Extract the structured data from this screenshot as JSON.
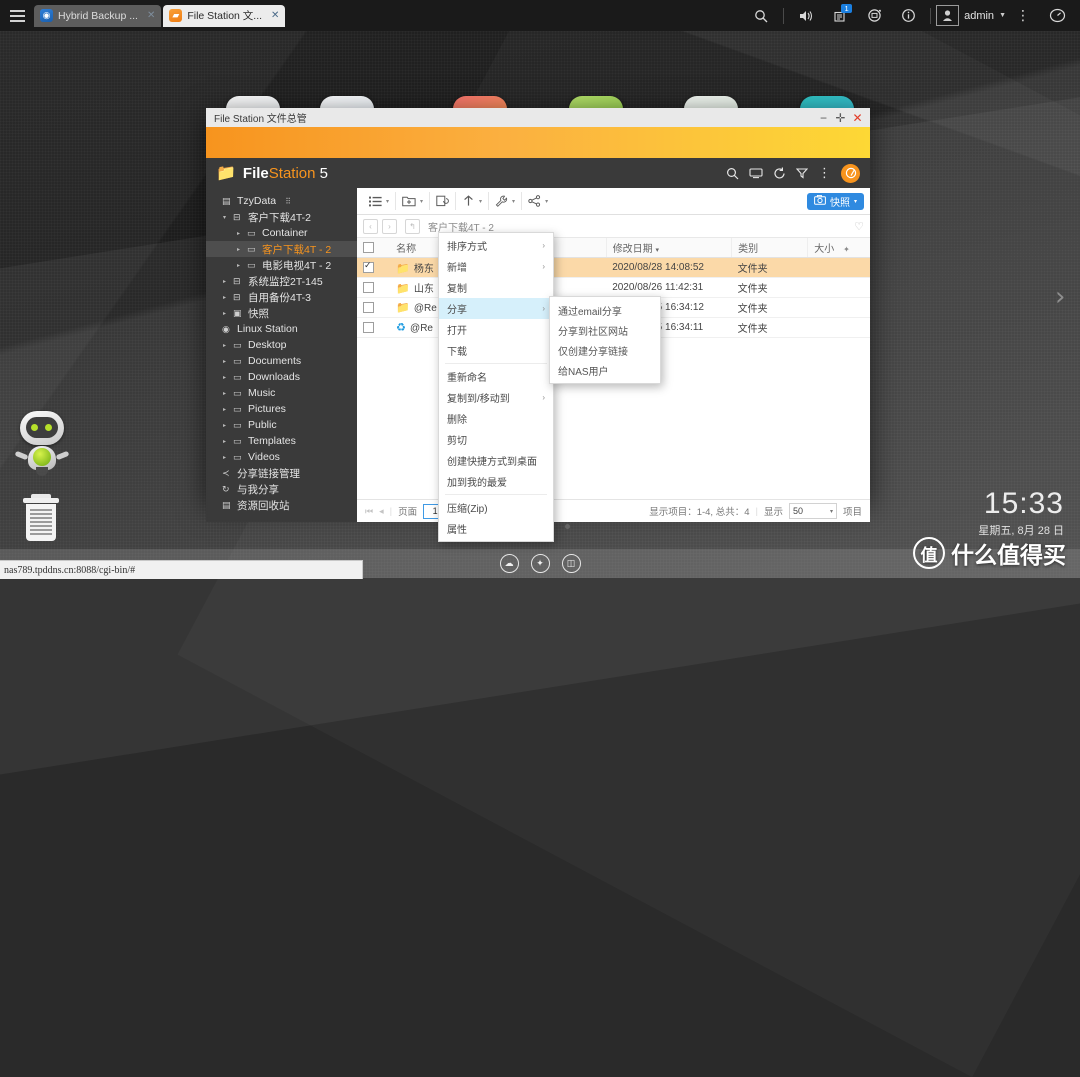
{
  "topbar": {
    "menu_icon": "hamburger-icon",
    "tabs": [
      {
        "label": "Hybrid Backup ...",
        "icon": "hybrid-backup-icon",
        "active": false,
        "close": "✕"
      },
      {
        "label": "File Station 文...",
        "icon": "file-station-icon",
        "active": true,
        "close": "✕"
      }
    ],
    "icons": [
      {
        "name": "search-icon",
        "glyph": "⌕"
      },
      {
        "name": "volume-icon",
        "glyph": "🔊"
      },
      {
        "name": "notifications-icon",
        "glyph": "▤",
        "badge": "1"
      },
      {
        "name": "background-tasks-icon",
        "glyph": "⟳"
      },
      {
        "name": "info-icon",
        "glyph": "ⓘ"
      }
    ],
    "admin_label": "admin",
    "admin_caret": "▼",
    "more_icon": "more-vertical-icon",
    "dashboard_icon": "dashboard-icon"
  },
  "window": {
    "titlebar_text": "File Station 文件总管",
    "minimize": "−",
    "maximize": "✛",
    "close": "✕",
    "app_name_bold": "File",
    "app_name_rest": "Station",
    "app_version": "5",
    "header_icons": [
      {
        "name": "search-icon",
        "glyph": "⌕"
      },
      {
        "name": "remote-connection-icon",
        "glyph": "▭"
      },
      {
        "name": "refresh-icon",
        "glyph": "⟳"
      },
      {
        "name": "filter-icon",
        "glyph": "▽"
      },
      {
        "name": "more-options-icon",
        "glyph": "⋮"
      }
    ],
    "help_icon": "help-icon"
  },
  "sidebar": {
    "items": [
      {
        "label": "TzyData",
        "depth": 1,
        "icon": "server-icon",
        "arrow": "",
        "selected": false,
        "extra": "⠿"
      },
      {
        "label": "客户下载4T-2",
        "depth": 2,
        "icon": "volume-icon",
        "arrow": "▾",
        "selected": false
      },
      {
        "label": "Container",
        "depth": 3,
        "icon": "folder-icon",
        "arrow": "▸",
        "selected": false
      },
      {
        "label": "客户下载4T - 2",
        "depth": 3,
        "icon": "folder-icon",
        "arrow": "▸",
        "selected": true
      },
      {
        "label": "电影电视4T - 2",
        "depth": 3,
        "icon": "folder-icon",
        "arrow": "▸",
        "selected": false
      },
      {
        "label": "系统监控2T-145",
        "depth": 2,
        "icon": "volume-icon",
        "arrow": "▸",
        "selected": false
      },
      {
        "label": "自用备份4T-3",
        "depth": 2,
        "icon": "volume-icon",
        "arrow": "▸",
        "selected": false
      },
      {
        "label": "快照",
        "depth": 2,
        "icon": "snapshot-icon",
        "arrow": "▸",
        "selected": false
      },
      {
        "label": "Linux Station",
        "depth": 1,
        "icon": "linux-station-icon",
        "arrow": "",
        "selected": false
      },
      {
        "label": "Desktop",
        "depth": 2,
        "icon": "folder-icon",
        "arrow": "▸",
        "selected": false
      },
      {
        "label": "Documents",
        "depth": 2,
        "icon": "folder-icon",
        "arrow": "▸",
        "selected": false
      },
      {
        "label": "Downloads",
        "depth": 2,
        "icon": "folder-icon",
        "arrow": "▸",
        "selected": false
      },
      {
        "label": "Music",
        "depth": 2,
        "icon": "folder-icon",
        "arrow": "▸",
        "selected": false
      },
      {
        "label": "Pictures",
        "depth": 2,
        "icon": "folder-icon",
        "arrow": "▸",
        "selected": false
      },
      {
        "label": "Public",
        "depth": 2,
        "icon": "folder-icon",
        "arrow": "▸",
        "selected": false
      },
      {
        "label": "Templates",
        "depth": 2,
        "icon": "folder-icon",
        "arrow": "▸",
        "selected": false
      },
      {
        "label": "Videos",
        "depth": 2,
        "icon": "folder-icon",
        "arrow": "▸",
        "selected": false
      },
      {
        "label": "分享链接管理",
        "depth": 1,
        "icon": "share-link-icon",
        "arrow": "",
        "selected": false
      },
      {
        "label": "与我分享",
        "depth": 1,
        "icon": "shared-with-me-icon",
        "arrow": "",
        "selected": false
      },
      {
        "label": "资源回收站",
        "depth": 1,
        "icon": "recycle-bin-icon",
        "arrow": "",
        "selected": false
      }
    ]
  },
  "toolbar": {
    "buttons": [
      {
        "name": "view-mode-button",
        "glyph": "☰",
        "caret": "▾"
      },
      {
        "name": "create-folder-button",
        "glyph": "▣",
        "caret": "▾"
      },
      {
        "name": "copy-button",
        "glyph": "⧉",
        "caret": ""
      },
      {
        "name": "upload-button",
        "glyph": "↥",
        "caret": "▾"
      },
      {
        "name": "tools-button",
        "glyph": "🔧",
        "caret": "▾"
      },
      {
        "name": "share-button",
        "glyph": "⤳",
        "caret": "▾"
      }
    ],
    "snapshot_label": "快照",
    "snapshot_caret": "▾",
    "snapshot_icon": "camera-icon",
    "snapshot_color": "#2f8ae0"
  },
  "path": {
    "back": "‹",
    "forward": "›",
    "up": "↰",
    "current": "客户下载4T - 2",
    "favorite_icon": "heart-icon"
  },
  "filelist": {
    "columns": [
      "名称",
      "修改日期",
      "类别",
      "大小"
    ],
    "sort_indicator": "▾",
    "column_settings_icon": "columns-settings-icon",
    "rows": [
      {
        "checked": true,
        "icon": "folder-icon",
        "name": "杨东",
        "date": "2020/08/28 14:08:52",
        "type": "文件夹",
        "size": ""
      },
      {
        "checked": false,
        "icon": "folder-icon",
        "name": "山东",
        "date": "2020/08/26 11:42:31",
        "type": "文件夹",
        "size": ""
      },
      {
        "checked": false,
        "icon": "folder-icon",
        "name": "@Re",
        "date": "2020/08/25 16:34:12",
        "type": "文件夹",
        "size": ""
      },
      {
        "checked": false,
        "icon": "recycle-bin-icon",
        "name": "@Re",
        "date": "2020/08/25 16:34:11",
        "type": "文件夹",
        "size": ""
      }
    ]
  },
  "statusbar": {
    "first_page": "⏮",
    "prev_page": "◂",
    "page_label": "页面",
    "page_value": "1",
    "items_shown": "显示项目：1-4, 总共：4",
    "show_label": "显示",
    "page_size": "50",
    "page_size_caret": "▾",
    "items_suffix": "项目"
  },
  "context_menu": {
    "items": [
      {
        "label": "排序方式",
        "submenu": "›",
        "highlight": false,
        "sep_after": false
      },
      {
        "label": "新增",
        "submenu": "›",
        "highlight": false,
        "sep_after": false
      },
      {
        "label": "复制",
        "submenu": "",
        "highlight": false,
        "sep_after": false
      },
      {
        "label": "分享",
        "submenu": "›",
        "highlight": true,
        "sep_after": false
      },
      {
        "label": "打开",
        "submenu": "",
        "highlight": false,
        "sep_after": false
      },
      {
        "label": "下载",
        "submenu": "",
        "highlight": false,
        "sep_after": true
      },
      {
        "label": "重新命名",
        "submenu": "",
        "highlight": false,
        "sep_after": false
      },
      {
        "label": "复制到/移动到",
        "submenu": "›",
        "highlight": false,
        "sep_after": false
      },
      {
        "label": "删除",
        "submenu": "",
        "highlight": false,
        "sep_after": false
      },
      {
        "label": "剪切",
        "submenu": "",
        "highlight": false,
        "sep_after": false
      },
      {
        "label": "创建快捷方式到桌面",
        "submenu": "",
        "highlight": false,
        "sep_after": false
      },
      {
        "label": "加到我的最爱",
        "submenu": "",
        "highlight": false,
        "sep_after": true
      },
      {
        "label": "压缩(Zip)",
        "submenu": "",
        "highlight": false,
        "sep_after": false
      },
      {
        "label": "属性",
        "submenu": "",
        "highlight": false,
        "sep_after": false
      }
    ],
    "submenu_items": [
      {
        "label": "通过email分享"
      },
      {
        "label": "分享到社区网站"
      },
      {
        "label": "仅创建分享链接"
      },
      {
        "label": "给NAS用户"
      }
    ]
  },
  "desktop": {
    "robot_icon": "robot-mascot-icon",
    "trash_icon": "recycle-bin-desktop-icon",
    "page_dots": [
      true,
      false,
      false
    ],
    "tray_icons": [
      {
        "name": "qsync-icon",
        "glyph": "☁"
      },
      {
        "name": "tools-icon",
        "glyph": "🔧"
      },
      {
        "name": "resource-monitor-icon",
        "glyph": "◫"
      }
    ],
    "nav_right_icon": "chevron-right-icon"
  },
  "clock": {
    "time": "15:33",
    "date": "星期五, 8月 28 日"
  },
  "watermark": {
    "mark": "值",
    "text": "什么值得买"
  },
  "urlbar": {
    "url": "nas789.tpddns.cn:8088/cgi-bin/#"
  },
  "colors": {
    "accent_orange": "#f7941e",
    "accent_blue": "#2f8ae0",
    "selected_row": "#fbd9a8",
    "submenu_highlight": "#d6f0fb"
  }
}
